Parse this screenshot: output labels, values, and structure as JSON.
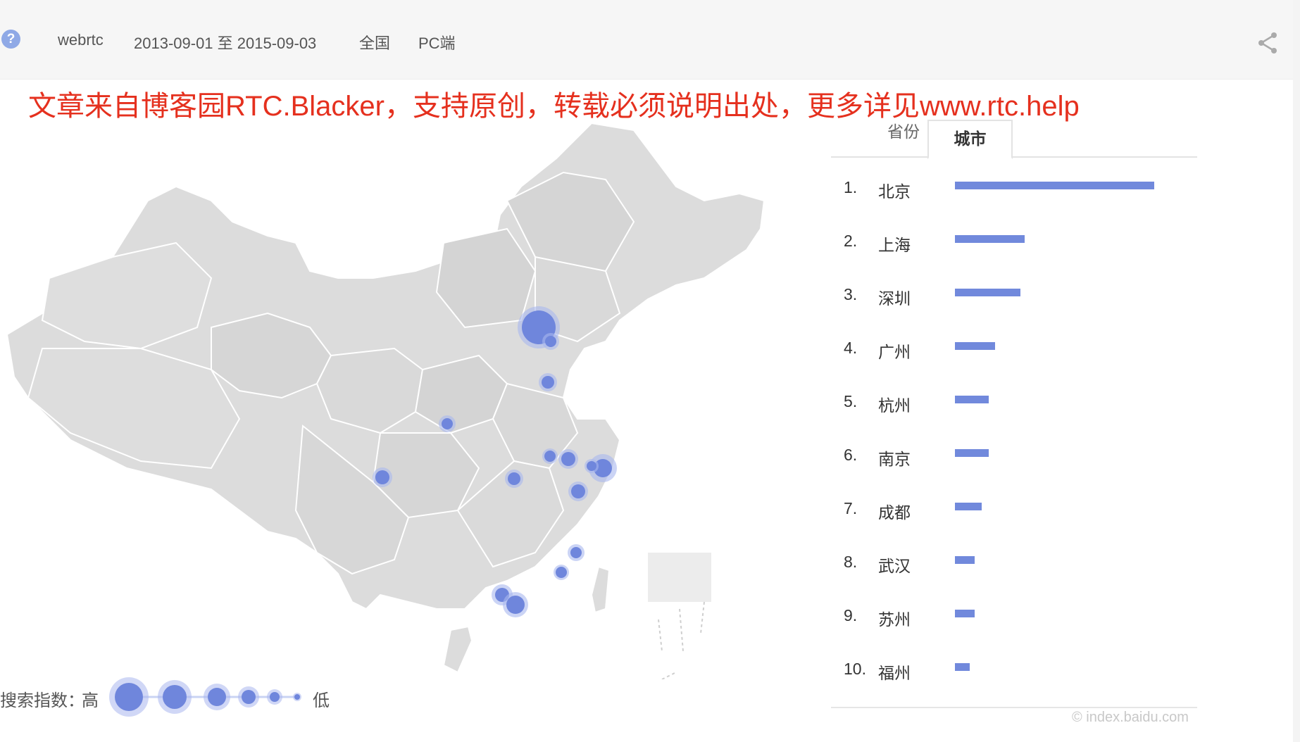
{
  "header": {
    "keyword": "webrtc",
    "date_range": "2013-09-01 至 2015-09-03",
    "region": "全国",
    "device": "PC端"
  },
  "banner": "文章来自博客园RTC.Blacker，支持原创，转载必须说明出处，更多详见www.rtc.help",
  "tabs": [
    "省份",
    "城市"
  ],
  "active_tab": 1,
  "ranking": [
    {
      "rank": "1.",
      "city": "北京",
      "value": 100
    },
    {
      "rank": "2.",
      "city": "上海",
      "value": 35
    },
    {
      "rank": "3.",
      "city": "深圳",
      "value": 33
    },
    {
      "rank": "4.",
      "city": "广州",
      "value": 20
    },
    {
      "rank": "5.",
      "city": "杭州",
      "value": 17
    },
    {
      "rank": "6.",
      "city": "南京",
      "value": 17
    },
    {
      "rank": "7.",
      "city": "成都",
      "value": 13.5
    },
    {
      "rank": "8.",
      "city": "武汉",
      "value": 10
    },
    {
      "rank": "9.",
      "city": "苏州",
      "value": 10
    },
    {
      "rank": "10.",
      "city": "福州",
      "value": 7.5
    }
  ],
  "legend": {
    "label": "搜索指数：",
    "high": "高",
    "low": "低"
  },
  "watermark": "© index.baidu.com",
  "colors": {
    "accent": "#7189dc",
    "banner": "#e5301e",
    "map_fill": "#dcdcdc"
  }
}
